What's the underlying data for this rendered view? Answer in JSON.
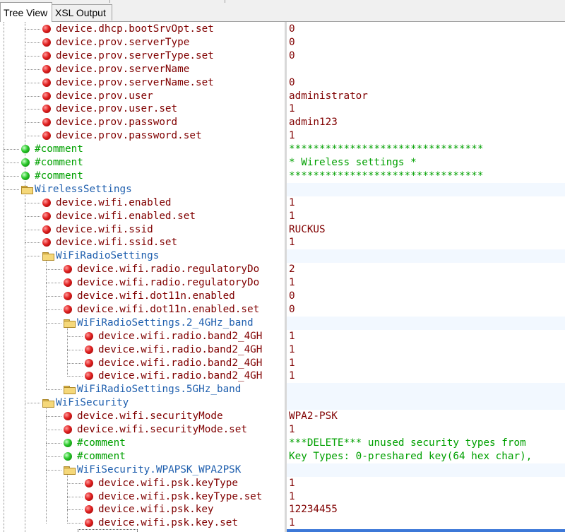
{
  "tabs": [
    {
      "label": "Tree View",
      "active": true
    },
    {
      "label": "XSL Output",
      "active": false
    }
  ],
  "rows": [
    {
      "level": 2,
      "kind": "prop",
      "name": "device.dhcp.bootSrvOpt.set",
      "value": "0"
    },
    {
      "level": 2,
      "kind": "prop",
      "name": "device.prov.serverType",
      "value": "0"
    },
    {
      "level": 2,
      "kind": "prop",
      "name": "device.prov.serverType.set",
      "value": "0"
    },
    {
      "level": 2,
      "kind": "prop",
      "name": "device.prov.serverName",
      "value": ""
    },
    {
      "level": 2,
      "kind": "prop",
      "name": "device.prov.serverName.set",
      "value": "0"
    },
    {
      "level": 2,
      "kind": "prop",
      "name": "device.prov.user",
      "value": "administrator"
    },
    {
      "level": 2,
      "kind": "prop",
      "name": "device.prov.user.set",
      "value": "1"
    },
    {
      "level": 2,
      "kind": "prop",
      "name": "device.prov.password",
      "value": "admin123"
    },
    {
      "level": 2,
      "kind": "prop",
      "name": "device.prov.password.set",
      "value": "1"
    },
    {
      "level": 1,
      "kind": "comment",
      "name": "#comment",
      "value": "********************************"
    },
    {
      "level": 1,
      "kind": "comment",
      "name": "#comment",
      "value": "* Wireless settings            *"
    },
    {
      "level": 1,
      "kind": "comment",
      "name": "#comment",
      "value": "********************************"
    },
    {
      "level": 1,
      "kind": "group",
      "name": "WirelessSettings",
      "expanded": true,
      "value": ""
    },
    {
      "level": 2,
      "kind": "prop",
      "name": "device.wifi.enabled",
      "value": "1"
    },
    {
      "level": 2,
      "kind": "prop",
      "name": "device.wifi.enabled.set",
      "value": "1"
    },
    {
      "level": 2,
      "kind": "prop",
      "name": "device.wifi.ssid",
      "value": "RUCKUS"
    },
    {
      "level": 2,
      "kind": "prop",
      "name": "device.wifi.ssid.set",
      "value": "1"
    },
    {
      "level": 2,
      "kind": "group",
      "name": "WiFiRadioSettings",
      "expanded": true,
      "value": ""
    },
    {
      "level": 3,
      "kind": "prop",
      "name": "device.wifi.radio.regulatoryDo",
      "value": "2"
    },
    {
      "level": 3,
      "kind": "prop",
      "name": "device.wifi.radio.regulatoryDo",
      "value": "1"
    },
    {
      "level": 3,
      "kind": "prop",
      "name": "device.wifi.dot11n.enabled",
      "value": "0"
    },
    {
      "level": 3,
      "kind": "prop",
      "name": "device.wifi.dot11n.enabled.set",
      "value": "0"
    },
    {
      "level": 3,
      "kind": "group",
      "name": "WiFiRadioSettings.2_4GHz_band",
      "expanded": true,
      "value": ""
    },
    {
      "level": 4,
      "kind": "prop",
      "name": "device.wifi.radio.band2_4GH",
      "value": "1"
    },
    {
      "level": 4,
      "kind": "prop",
      "name": "device.wifi.radio.band2_4GH",
      "value": "1"
    },
    {
      "level": 4,
      "kind": "prop",
      "name": "device.wifi.radio.band2_4GH",
      "value": "1"
    },
    {
      "level": 4,
      "kind": "prop",
      "name": "device.wifi.radio.band2_4GH",
      "value": "1"
    },
    {
      "level": 3,
      "kind": "group",
      "name": "WiFiRadioSettings.5GHz_band",
      "expanded": false,
      "value": ""
    },
    {
      "level": 2,
      "kind": "group",
      "name": "WiFiSecurity",
      "expanded": true,
      "value": ""
    },
    {
      "level": 3,
      "kind": "prop",
      "name": "device.wifi.securityMode",
      "value": "WPA2-PSK"
    },
    {
      "level": 3,
      "kind": "prop",
      "name": "device.wifi.securityMode.set",
      "value": "1"
    },
    {
      "level": 3,
      "kind": "comment",
      "name": "#comment",
      "value": "***DELETE*** unused security types from"
    },
    {
      "level": 3,
      "kind": "comment",
      "name": "#comment",
      "value": "Key Types: 0-preshared key(64 hex char),"
    },
    {
      "level": 3,
      "kind": "group",
      "name": "WiFiSecurity.WPAPSK_WPA2PSK",
      "expanded": true,
      "value": ""
    },
    {
      "level": 4,
      "kind": "prop",
      "name": "device.wifi.psk.keyType",
      "value": "1"
    },
    {
      "level": 4,
      "kind": "prop",
      "name": "device.wifi.psk.keyType.set",
      "value": "1"
    },
    {
      "level": 4,
      "kind": "prop",
      "name": "device.wifi.psk.key",
      "value": "12234455"
    },
    {
      "level": 4,
      "kind": "prop",
      "name": "device.wifi.psk.key.set",
      "value": "1"
    }
  ],
  "colors": {
    "property_text": "#800000",
    "comment_text": "#00a000",
    "group_text": "#1f5fae",
    "group_row_shade": "#f2f8ff"
  }
}
